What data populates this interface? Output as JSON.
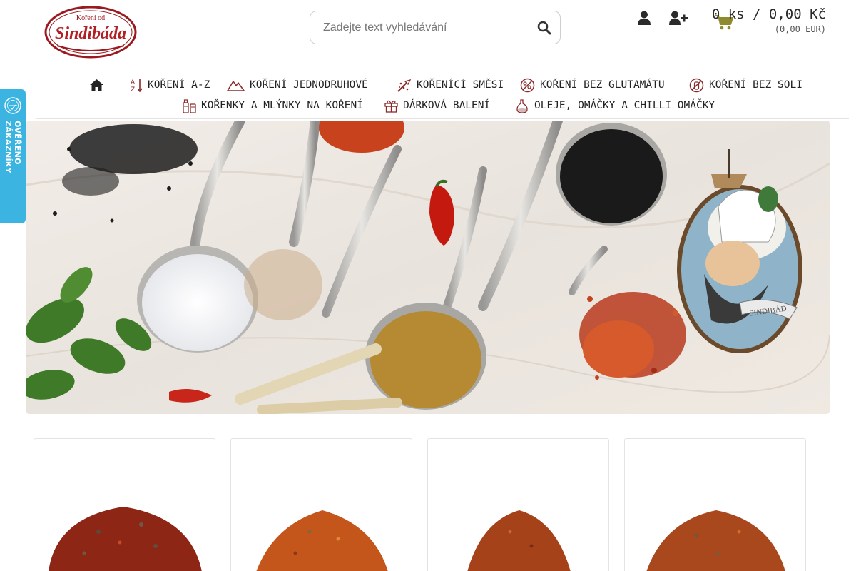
{
  "header": {
    "logo_text_top": "Koření od",
    "logo_text_main": "Sindibáda",
    "search_placeholder": "Zadejte text vyhledávání",
    "cart_summary": "0 ks / 0,00 Kč",
    "cart_eur": "(0,00 EUR)",
    "icons": [
      "user-icon",
      "add-user-icon",
      "shopping-cart-icon",
      "search-icon"
    ]
  },
  "nav": {
    "items": [
      {
        "label": "",
        "icon": "home-icon"
      },
      {
        "label": "Koření A-Z",
        "icon": "az-sort-icon"
      },
      {
        "label": "Koření jednodruhové",
        "icon": "mountain-icon"
      },
      {
        "label": "Kořenící směsi",
        "icon": "mix-icon"
      },
      {
        "label": "Koření bez glutamátu",
        "icon": "no-glutamate-icon"
      },
      {
        "label": "Koření bez soli",
        "icon": "no-salt-icon"
      },
      {
        "label": "Kořenky a mlýnky na koření",
        "icon": "grinder-icon"
      },
      {
        "label": "Dárková balení",
        "icon": "gift-icon"
      },
      {
        "label": "Oleje, omáčky a chilli omáčky",
        "icon": "oil-bottle-icon"
      }
    ],
    "accent": "#8a2a2a"
  },
  "badge": {
    "text": "OVĚŘENO ZÁKAZNÍKY",
    "color": "#3cb4e2"
  },
  "hero": {
    "banner_label": "SINDIBÁD"
  },
  "products": {
    "items": [
      {
        "spice_color": "#8e2616"
      },
      {
        "spice_color": "#c4561c"
      },
      {
        "spice_color": "#a5421a"
      },
      {
        "spice_color": "#a9471d"
      }
    ]
  }
}
